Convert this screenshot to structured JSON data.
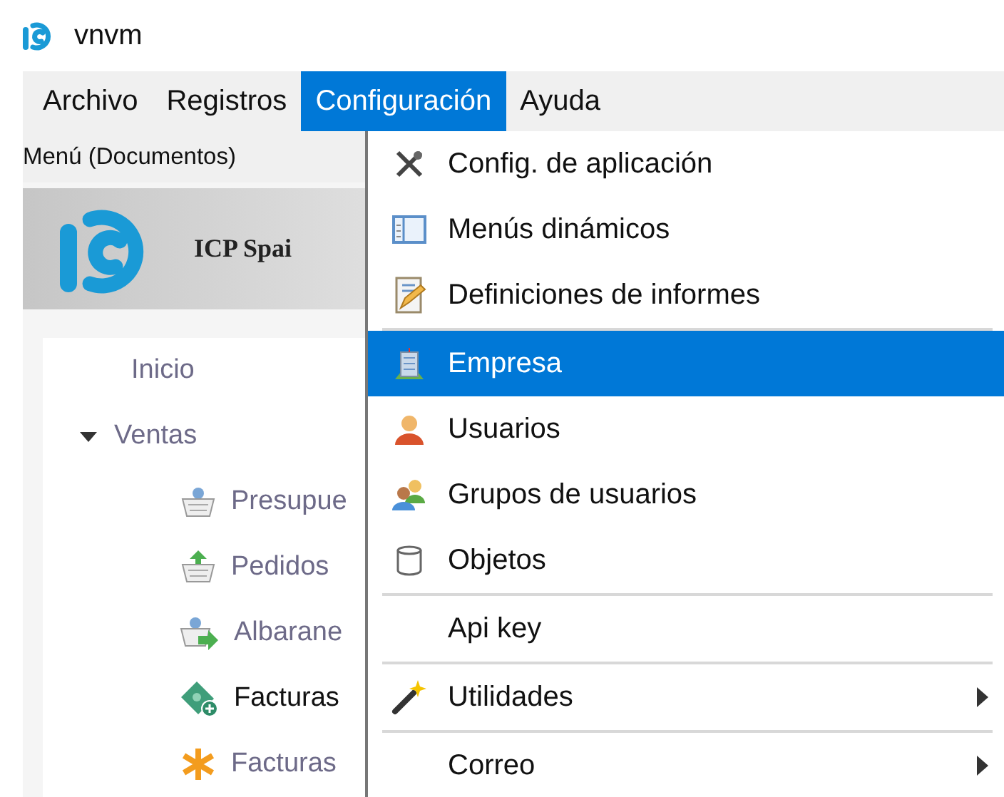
{
  "window": {
    "title": "vnvm"
  },
  "menu_bar": [
    {
      "label": "Archivo",
      "selected": false
    },
    {
      "label": "Registros",
      "selected": false
    },
    {
      "label": "Configuración",
      "selected": true
    },
    {
      "label": "Ayuda",
      "selected": false
    }
  ],
  "side_panel": {
    "title": "Menú (Documentos)",
    "company": "ICP Spai",
    "tree": [
      {
        "label": "Inicio",
        "highlighted": false
      },
      {
        "label": "Ventas",
        "expanded": true,
        "highlighted": false,
        "children": [
          {
            "label": "Presupue",
            "highlighted": false
          },
          {
            "label": "Pedidos",
            "highlighted": false
          },
          {
            "label": "Albarane",
            "highlighted": false
          },
          {
            "label": "Facturas",
            "highlighted": true
          },
          {
            "label": "Facturas",
            "highlighted": false
          }
        ]
      }
    ]
  },
  "dropdown": [
    {
      "kind": "item",
      "label": "Config. de aplicación",
      "selected": false,
      "submenu": false
    },
    {
      "kind": "item",
      "label": "Menús dinámicos",
      "selected": false,
      "submenu": false
    },
    {
      "kind": "item",
      "label": "Definiciones de informes",
      "selected": false,
      "submenu": false
    },
    {
      "kind": "separator"
    },
    {
      "kind": "item",
      "label": "Empresa",
      "selected": true,
      "submenu": false
    },
    {
      "kind": "item",
      "label": "Usuarios",
      "selected": false,
      "submenu": false
    },
    {
      "kind": "item",
      "label": "Grupos de usuarios",
      "selected": false,
      "submenu": false
    },
    {
      "kind": "item",
      "label": "Objetos",
      "selected": false,
      "submenu": false
    },
    {
      "kind": "separator"
    },
    {
      "kind": "item",
      "label": "Api key",
      "selected": false,
      "submenu": false
    },
    {
      "kind": "separator"
    },
    {
      "kind": "item",
      "label": "Utilidades",
      "selected": false,
      "submenu": true
    },
    {
      "kind": "separator"
    },
    {
      "kind": "item",
      "label": "Correo",
      "selected": false,
      "submenu": true
    }
  ]
}
